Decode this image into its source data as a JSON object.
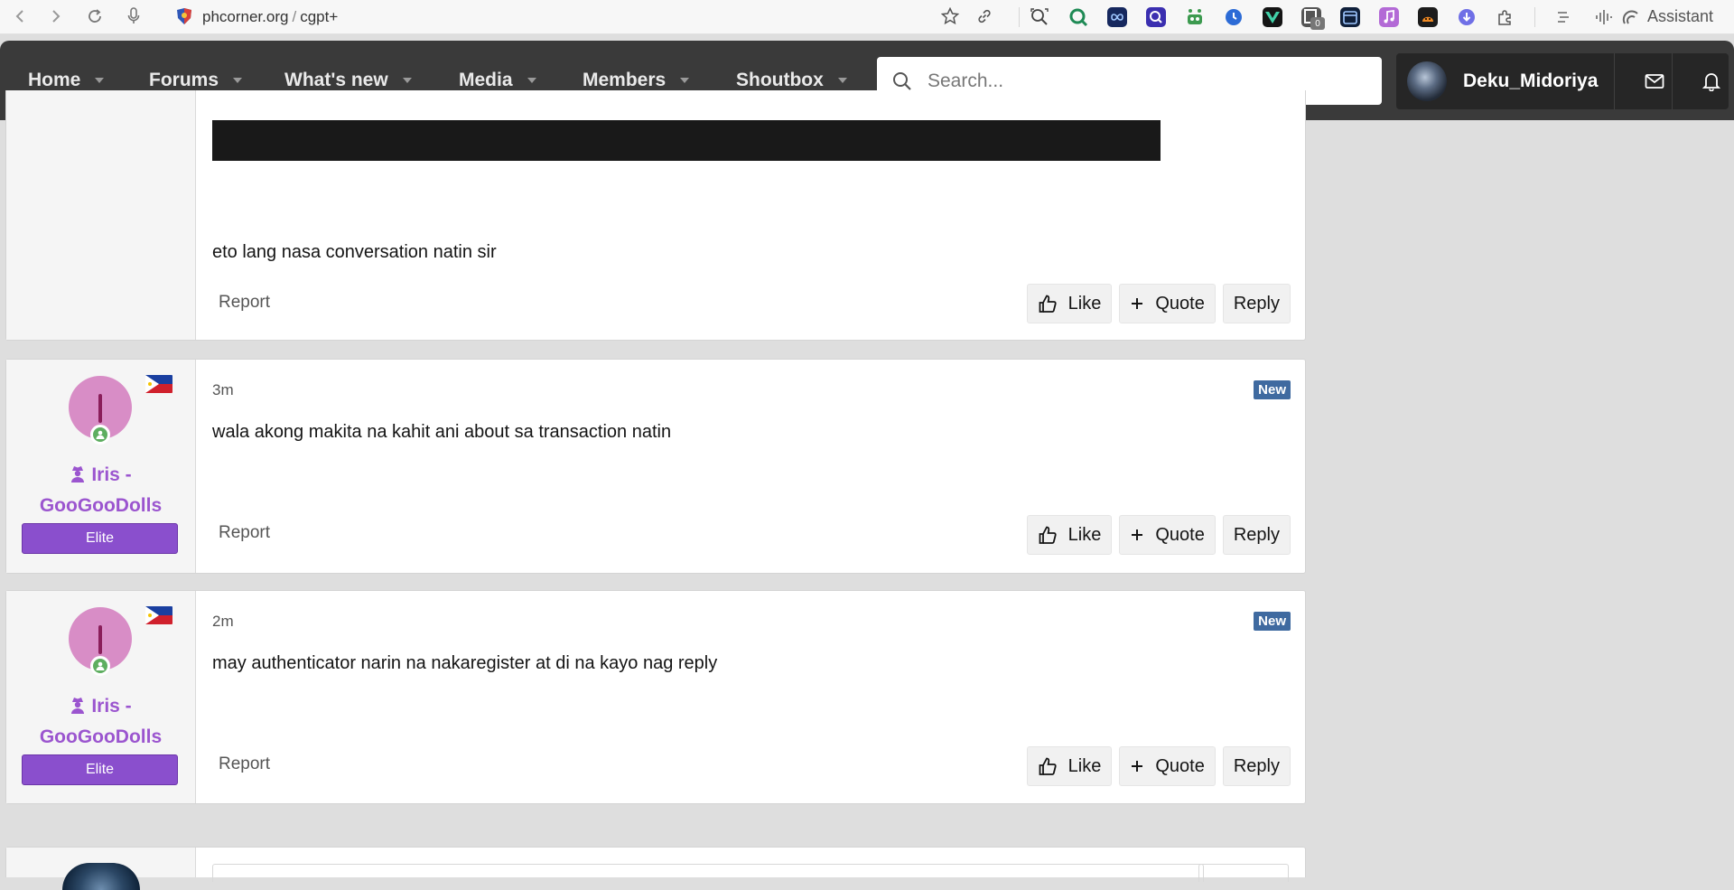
{
  "browser": {
    "url_domain": "phcorner.org",
    "url_path": "cgpt+",
    "assistant_label": "Assistant",
    "extension_badge": "0"
  },
  "nav": {
    "items": [
      {
        "label": "Home"
      },
      {
        "label": "Forums"
      },
      {
        "label": "What's new"
      },
      {
        "label": "Media"
      },
      {
        "label": "Members"
      },
      {
        "label": "Shoutbox"
      }
    ],
    "search_placeholder": "Search...",
    "username": "Deku_Midoriya"
  },
  "posts": [
    {
      "body": "eto lang nasa conversation natin sir",
      "report": "Report",
      "like": "Like",
      "quote": "Quote",
      "reply": "Reply"
    },
    {
      "avatar_letter": "I",
      "author_line1": "Iris -",
      "author_line2": "GooGooDolls",
      "rank": "Elite",
      "time": "3m",
      "badge": "New",
      "body": "wala akong makita na kahit ani about sa transaction natin",
      "report": "Report",
      "like": "Like",
      "quote": "Quote",
      "reply": "Reply"
    },
    {
      "avatar_letter": "I",
      "author_line1": "Iris -",
      "author_line2": "GooGooDolls",
      "rank": "Elite",
      "time": "2m",
      "badge": "New",
      "body": "may authenticator narin na nakaregister at di na kayo nag reply",
      "report": "Report",
      "like": "Like",
      "quote": "Quote",
      "reply": "Reply"
    }
  ],
  "colors": {
    "nav_bg": "#3a3a3a",
    "username_purple": "#9b55cf",
    "rank_purple": "#8a4fcd",
    "new_badge": "#3f6aa0"
  }
}
